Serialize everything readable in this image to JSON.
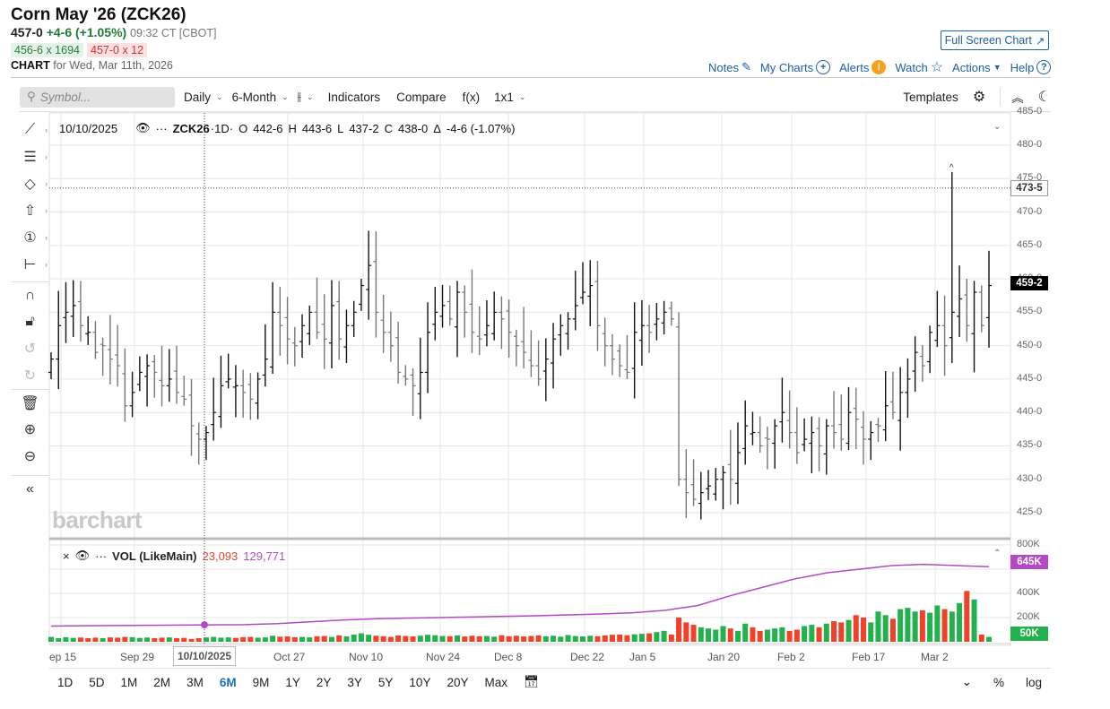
{
  "header": {
    "title": "Corn May '26 (ZCK26)",
    "last": "457-0",
    "change": "+4-6 (+1.05%)",
    "time": "09:32 CT [CBOT]",
    "bid": "456-6 x 1694",
    "ask": "457-0 x 12",
    "chart_label": "CHART",
    "chart_for": "for Wed, Mar 11th, 2026",
    "fullscreen": "Full Screen Chart"
  },
  "links": {
    "notes": "Notes",
    "mycharts": "My Charts",
    "alerts": "Alerts",
    "watch": "Watch",
    "actions": "Actions",
    "help": "Help"
  },
  "toolbar": {
    "symbol_placeholder": "Symbol...",
    "interval": "Daily",
    "range": "6-Month",
    "indicators": "Indicators",
    "compare": "Compare",
    "fx": "f(x)",
    "layout": "1x1",
    "templates": "Templates"
  },
  "legend": {
    "date": "10/10/2025",
    "symbol": "ZCK26",
    "period": "·1D·",
    "o_label": "O",
    "o": "442-6",
    "h_label": "H",
    "h": "443-6",
    "l_label": "L",
    "l": "437-2",
    "c_label": "C",
    "c": "438-0",
    "delta_label": "Δ",
    "delta": "-4-6 (-1.07%)"
  },
  "volume_legend": {
    "name": "VOL (LikeMain)",
    "vol": "23,093",
    "avg": "129,771"
  },
  "watermark": "barchart",
  "colors": {
    "up": "#22b14c",
    "down": "#f0422a",
    "avg": "#b548c6",
    "link": "#1b5fa8"
  },
  "chart_data": {
    "type": "ohlc",
    "price_axis": {
      "min": 425,
      "max": 485,
      "ticks": [
        "485-0",
        "480-0",
        "475-0",
        "470-0",
        "465-0",
        "460-0",
        "455-0",
        "450-0",
        "445-0",
        "440-0",
        "435-0",
        "430-0",
        "425-0"
      ]
    },
    "crosshair_price": "473-5",
    "last_price": "459-2",
    "volume_axis": {
      "ticks": [
        "800K",
        "400K",
        "200K"
      ],
      "avg_label": "645K",
      "vol_label": "50K"
    },
    "x_labels": [
      "ep 15",
      "Sep 29",
      "Oct 27",
      "Nov 10",
      "Nov 24",
      "Dec 8",
      "Dec 22",
      "Jan 5",
      "Jan 20",
      "Feb 2",
      "Feb 17",
      "Mar 2"
    ],
    "crosshair_date": "10/10/2025",
    "closes": [
      448,
      453,
      455,
      456,
      453,
      452,
      449,
      450,
      448,
      447,
      441,
      443,
      446,
      447,
      446,
      444,
      445,
      443,
      442,
      438,
      436,
      437,
      440,
      444,
      445,
      444,
      443,
      442,
      445,
      448,
      455,
      453,
      451,
      450,
      453,
      455,
      452,
      451,
      456,
      451,
      453,
      455,
      459,
      462,
      455,
      452,
      450,
      446,
      445,
      444,
      446,
      452,
      455,
      456,
      454,
      458,
      455,
      452,
      451,
      453,
      455,
      454,
      452,
      450,
      449,
      447,
      445,
      448,
      451,
      453,
      454,
      456,
      458,
      459,
      453,
      450,
      448,
      447,
      446,
      452,
      453,
      452,
      454,
      455,
      454,
      430,
      428,
      427,
      428,
      429,
      430,
      431,
      430,
      434,
      438,
      437,
      435,
      436,
      438,
      440,
      437,
      434,
      436,
      437,
      435,
      438,
      437,
      436,
      440,
      439,
      436,
      437,
      438,
      441,
      440,
      443,
      445,
      449,
      447,
      452,
      453,
      450,
      455,
      457,
      453,
      458,
      453,
      459
    ],
    "volumes_k": [
      40,
      30,
      38,
      32,
      35,
      30,
      34,
      30,
      36,
      34,
      40,
      38,
      32,
      35,
      30,
      34,
      36,
      30,
      32,
      23,
      30,
      36,
      40,
      34,
      36,
      32,
      38,
      40,
      34,
      36,
      50,
      42,
      44,
      38,
      40,
      36,
      46,
      48,
      40,
      52,
      44,
      60,
      70,
      58,
      50,
      46,
      40,
      52,
      48,
      44,
      50,
      58,
      54,
      48,
      46,
      52,
      44,
      50,
      46,
      48,
      42,
      54,
      46,
      50,
      44,
      48,
      52,
      46,
      50,
      42,
      56,
      48,
      44,
      50,
      46,
      52,
      58,
      60,
      54,
      62,
      66,
      70,
      80,
      90,
      60,
      200,
      160,
      140,
      120,
      110,
      100,
      130,
      110,
      90,
      150,
      120,
      90,
      100,
      110,
      120,
      90,
      100,
      130,
      140,
      120,
      150,
      170,
      160,
      180,
      220,
      200,
      160,
      250,
      220,
      190,
      270,
      280,
      250,
      260,
      240,
      300,
      270,
      250,
      320,
      420,
      350,
      60
    ],
    "avg_k": [
      130,
      132,
      134,
      136,
      138,
      140,
      142,
      150,
      165,
      180,
      190,
      195,
      200,
      205,
      210,
      215,
      222,
      230,
      240,
      260,
      300,
      380,
      450,
      520,
      570,
      600,
      630,
      640,
      630,
      620
    ]
  }
}
